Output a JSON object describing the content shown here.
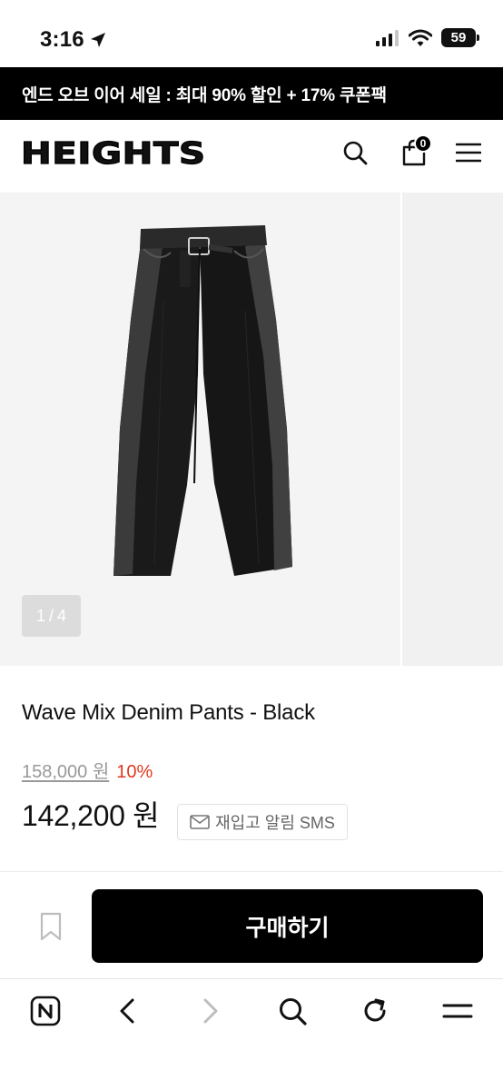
{
  "status": {
    "time": "3:16",
    "battery": "59"
  },
  "promo": {
    "text": "엔드 오브 이어 세일 : 최대 90% 할인 + 17% 쿠폰팩"
  },
  "header": {
    "logo": "HEIGHTS",
    "cart_count": "0"
  },
  "gallery": {
    "current": "1",
    "separator": "/",
    "total": "4"
  },
  "product": {
    "name": "Wave Mix Denim Pants - Black",
    "original_price": "158,000 원",
    "discount": "10%",
    "price": "142,200 원",
    "restock_label": "재입고 알림 SMS"
  },
  "actions": {
    "buy_label": "구매하기"
  },
  "icons": {
    "search": "search-icon",
    "cart": "cart-icon",
    "menu": "menu-icon",
    "bookmark": "bookmark-icon",
    "mail": "mail-icon"
  },
  "colors": {
    "accent": "#e0391e",
    "primary": "#000000",
    "banner": "#000000"
  }
}
